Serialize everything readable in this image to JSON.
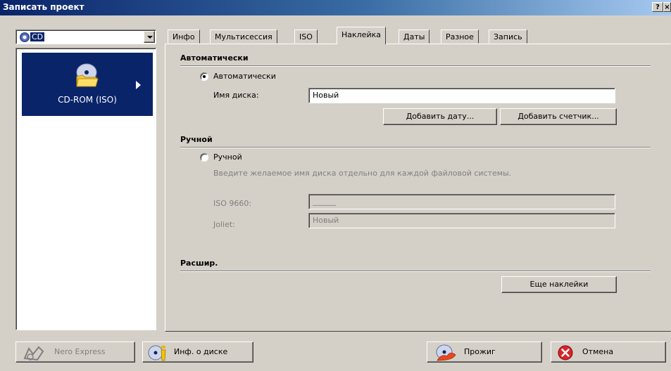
{
  "window": {
    "title": "Записать проект",
    "help_label": "?",
    "close_label": "×"
  },
  "device": {
    "selected": "CD"
  },
  "project_list": {
    "items": [
      {
        "label": "CD-ROM (ISO)",
        "selected": true
      }
    ]
  },
  "tabs": [
    {
      "label": "Инфо",
      "active": false
    },
    {
      "label": "Мультисессия",
      "active": false
    },
    {
      "label": "ISO",
      "active": false
    },
    {
      "label": "Наклейка",
      "active": true
    },
    {
      "label": "Даты",
      "active": false
    },
    {
      "label": "Разное",
      "active": false
    },
    {
      "label": "Запись",
      "active": false
    }
  ],
  "auto_section": {
    "header": "Автоматически",
    "radio_label": "Автоматически",
    "radio_checked": true,
    "disc_name_label": "Имя диска:",
    "disc_name_value": "Новый",
    "add_date_button": "Добавить дату...",
    "add_counter_button": "Добавить счетчик..."
  },
  "manual_section": {
    "header": "Ручной",
    "radio_label": "Ручной",
    "radio_checked": false,
    "description": "Введите желаемое имя диска отдельно для каждой файловой системы.",
    "iso_label": "ISO 9660:",
    "iso_value": "______",
    "joliet_label": "Joliet:",
    "joliet_value": "Новый"
  },
  "advanced_section": {
    "header": "Расшир.",
    "more_labels_button": "Еще наклейки"
  },
  "bottom_buttons": {
    "nero_express": "Nero Express",
    "disc_info": "Инф. о диске",
    "burn": "Прожиг",
    "cancel": "Отмена"
  }
}
